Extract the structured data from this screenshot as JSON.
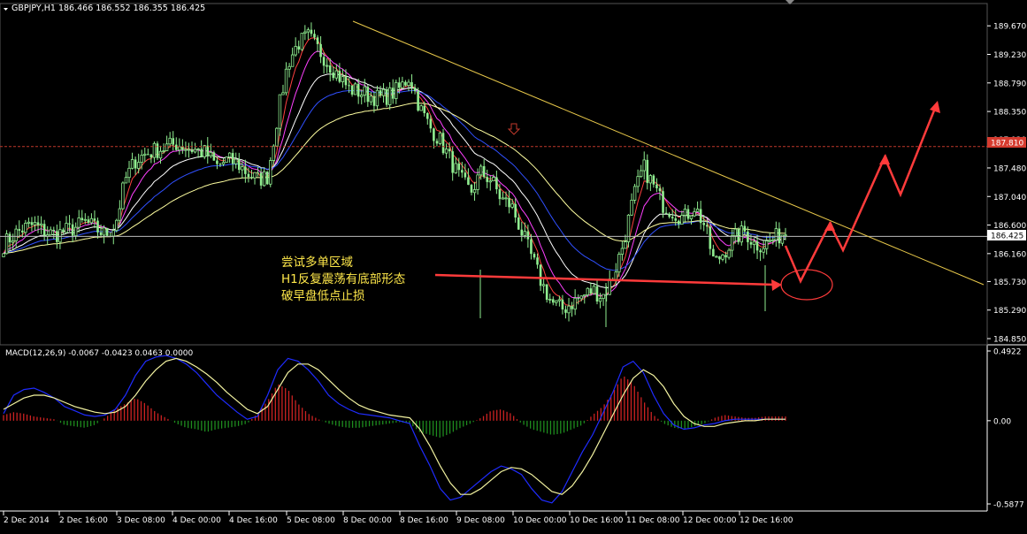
{
  "header": {
    "symbol_line": "GBPJPY,H1  186.466 186.552 186.355 186.425"
  },
  "macd_header": "MACD(12,26,9) -0.0067 -0.0423 0.0463 0.0000",
  "annotation": {
    "lines": [
      "尝试多单区域",
      "H1反复震荡有底部形态",
      "破早盘低点止损"
    ]
  },
  "colors": {
    "background": "#000000",
    "axis_text": "#ffffff",
    "bull_candle": "#90ee90",
    "bear_candle": "#90ee90",
    "trendline": "#e8c84a",
    "resistance": "#c0392b",
    "arrow": "#ff3b3b",
    "current_price_label_bg": "#ffffff",
    "resistance_label_bg": "#d63b2f",
    "macd_pos": "#cc2222",
    "macd_neg": "#1e8c1e",
    "macd_line": "#1f2cff",
    "signal_line": "#f2f2a0"
  },
  "chart_data": [
    {
      "type": "candlestick",
      "symbol": "GBPJPY",
      "timeframe": "H1",
      "ylim": [
        184.85,
        189.85
      ],
      "y_ticks": [
        "189.670",
        "189.230",
        "188.790",
        "188.350",
        "187.920",
        "187.480",
        "187.040",
        "186.600",
        "186.160",
        "185.730",
        "185.290",
        "184.850"
      ],
      "x_ticks": [
        "2 Dec 2014",
        "2 Dec 16:00",
        "3 Dec 08:00",
        "4 Dec 00:00",
        "4 Dec 16:00",
        "5 Dec 08:00",
        "8 Dec 00:00",
        "8 Dec 16:00",
        "9 Dec 08:00",
        "10 Dec 00:00",
        "10 Dec 16:00",
        "11 Dec 08:00",
        "12 Dec 00:00",
        "12 Dec 16:00"
      ],
      "current_price": "186.425",
      "resistance_level": "187.810",
      "close_path": [
        186.3,
        186.45,
        186.55,
        186.6,
        186.5,
        186.45,
        186.5,
        186.55,
        186.65,
        186.55,
        186.45,
        186.6,
        187.3,
        187.6,
        187.7,
        187.75,
        187.8,
        187.85,
        187.8,
        187.75,
        187.7,
        187.5,
        187.6,
        187.55,
        187.4,
        187.3,
        187.35,
        188.3,
        189.1,
        189.4,
        189.5,
        189.3,
        189.1,
        188.9,
        188.7,
        188.65,
        188.6,
        188.55,
        188.6,
        188.7,
        188.9,
        188.4,
        188.1,
        187.9,
        187.6,
        187.3,
        187.1,
        187.4,
        187.3,
        187.0,
        186.9,
        186.5,
        186.1,
        185.7,
        185.4,
        185.3,
        185.4,
        185.5,
        185.6,
        185.5,
        185.8,
        186.3,
        187.0,
        187.5,
        187.2,
        186.9,
        186.8,
        186.7,
        186.9,
        186.6,
        186.0,
        186.2,
        186.4,
        186.5,
        186.3,
        186.3,
        186.4,
        186.5
      ],
      "macd_ylim": [
        -0.5877,
        0.4922
      ],
      "macd_ticks": [
        "0.4922",
        "0.00",
        "-0.5877"
      ],
      "macd_hist": [
        0.04,
        0.06,
        0.05,
        0.03,
        0.02,
        0.01,
        -0.03,
        -0.04,
        -0.05,
        -0.03,
        0.02,
        0.08,
        0.12,
        0.16,
        0.12,
        0.06,
        0.02,
        -0.02,
        -0.05,
        -0.06,
        -0.08,
        -0.06,
        -0.05,
        -0.04,
        -0.02,
        0.05,
        0.14,
        0.26,
        0.22,
        0.12,
        0.05,
        0.01,
        -0.02,
        -0.04,
        -0.05,
        -0.05,
        -0.04,
        -0.03,
        -0.02,
        -0.01,
        -0.02,
        -0.08,
        -0.1,
        -0.12,
        -0.09,
        -0.05,
        -0.02,
        0.02,
        0.07,
        0.08,
        0.05,
        -0.02,
        -0.06,
        -0.08,
        -0.1,
        -0.09,
        -0.06,
        -0.03,
        0.04,
        0.1,
        0.2,
        0.32,
        0.26,
        0.14,
        0.04,
        -0.02,
        -0.05,
        -0.06,
        -0.04,
        -0.02,
        0.02,
        0.04,
        0.03,
        0.02,
        0.02,
        0.03,
        0.03,
        0.03
      ],
      "macd_line": [
        0.05,
        0.18,
        0.22,
        0.23,
        0.2,
        0.16,
        0.1,
        0.07,
        0.04,
        0.03,
        0.04,
        0.08,
        0.18,
        0.32,
        0.42,
        0.45,
        0.46,
        0.44,
        0.4,
        0.34,
        0.26,
        0.18,
        0.12,
        0.06,
        0.01,
        0.03,
        0.18,
        0.36,
        0.44,
        0.42,
        0.36,
        0.28,
        0.18,
        0.12,
        0.08,
        0.05,
        0.04,
        0.03,
        0.02,
        0.0,
        -0.02,
        -0.18,
        -0.32,
        -0.48,
        -0.56,
        -0.54,
        -0.48,
        -0.42,
        -0.36,
        -0.32,
        -0.34,
        -0.38,
        -0.48,
        -0.56,
        -0.58,
        -0.5,
        -0.36,
        -0.22,
        -0.1,
        0.05,
        0.2,
        0.38,
        0.42,
        0.34,
        0.18,
        0.05,
        -0.03,
        -0.06,
        -0.05,
        -0.03,
        -0.02,
        0.0,
        0.01,
        0.01,
        0.01,
        0.01,
        0.01,
        0.01
      ],
      "signal_line": [
        0.08,
        0.12,
        0.16,
        0.18,
        0.18,
        0.16,
        0.13,
        0.1,
        0.08,
        0.06,
        0.05,
        0.06,
        0.1,
        0.18,
        0.28,
        0.36,
        0.42,
        0.44,
        0.42,
        0.38,
        0.33,
        0.27,
        0.2,
        0.14,
        0.08,
        0.05,
        0.1,
        0.22,
        0.34,
        0.4,
        0.4,
        0.36,
        0.29,
        0.22,
        0.16,
        0.11,
        0.08,
        0.06,
        0.04,
        0.03,
        0.02,
        -0.06,
        -0.18,
        -0.32,
        -0.44,
        -0.52,
        -0.52,
        -0.48,
        -0.42,
        -0.36,
        -0.33,
        -0.34,
        -0.38,
        -0.44,
        -0.5,
        -0.52,
        -0.46,
        -0.36,
        -0.24,
        -0.1,
        0.04,
        0.18,
        0.3,
        0.36,
        0.32,
        0.24,
        0.12,
        0.03,
        -0.02,
        -0.04,
        -0.04,
        -0.02,
        -0.01,
        0.0,
        0.0,
        0.01,
        0.01,
        0.01
      ]
    }
  ]
}
